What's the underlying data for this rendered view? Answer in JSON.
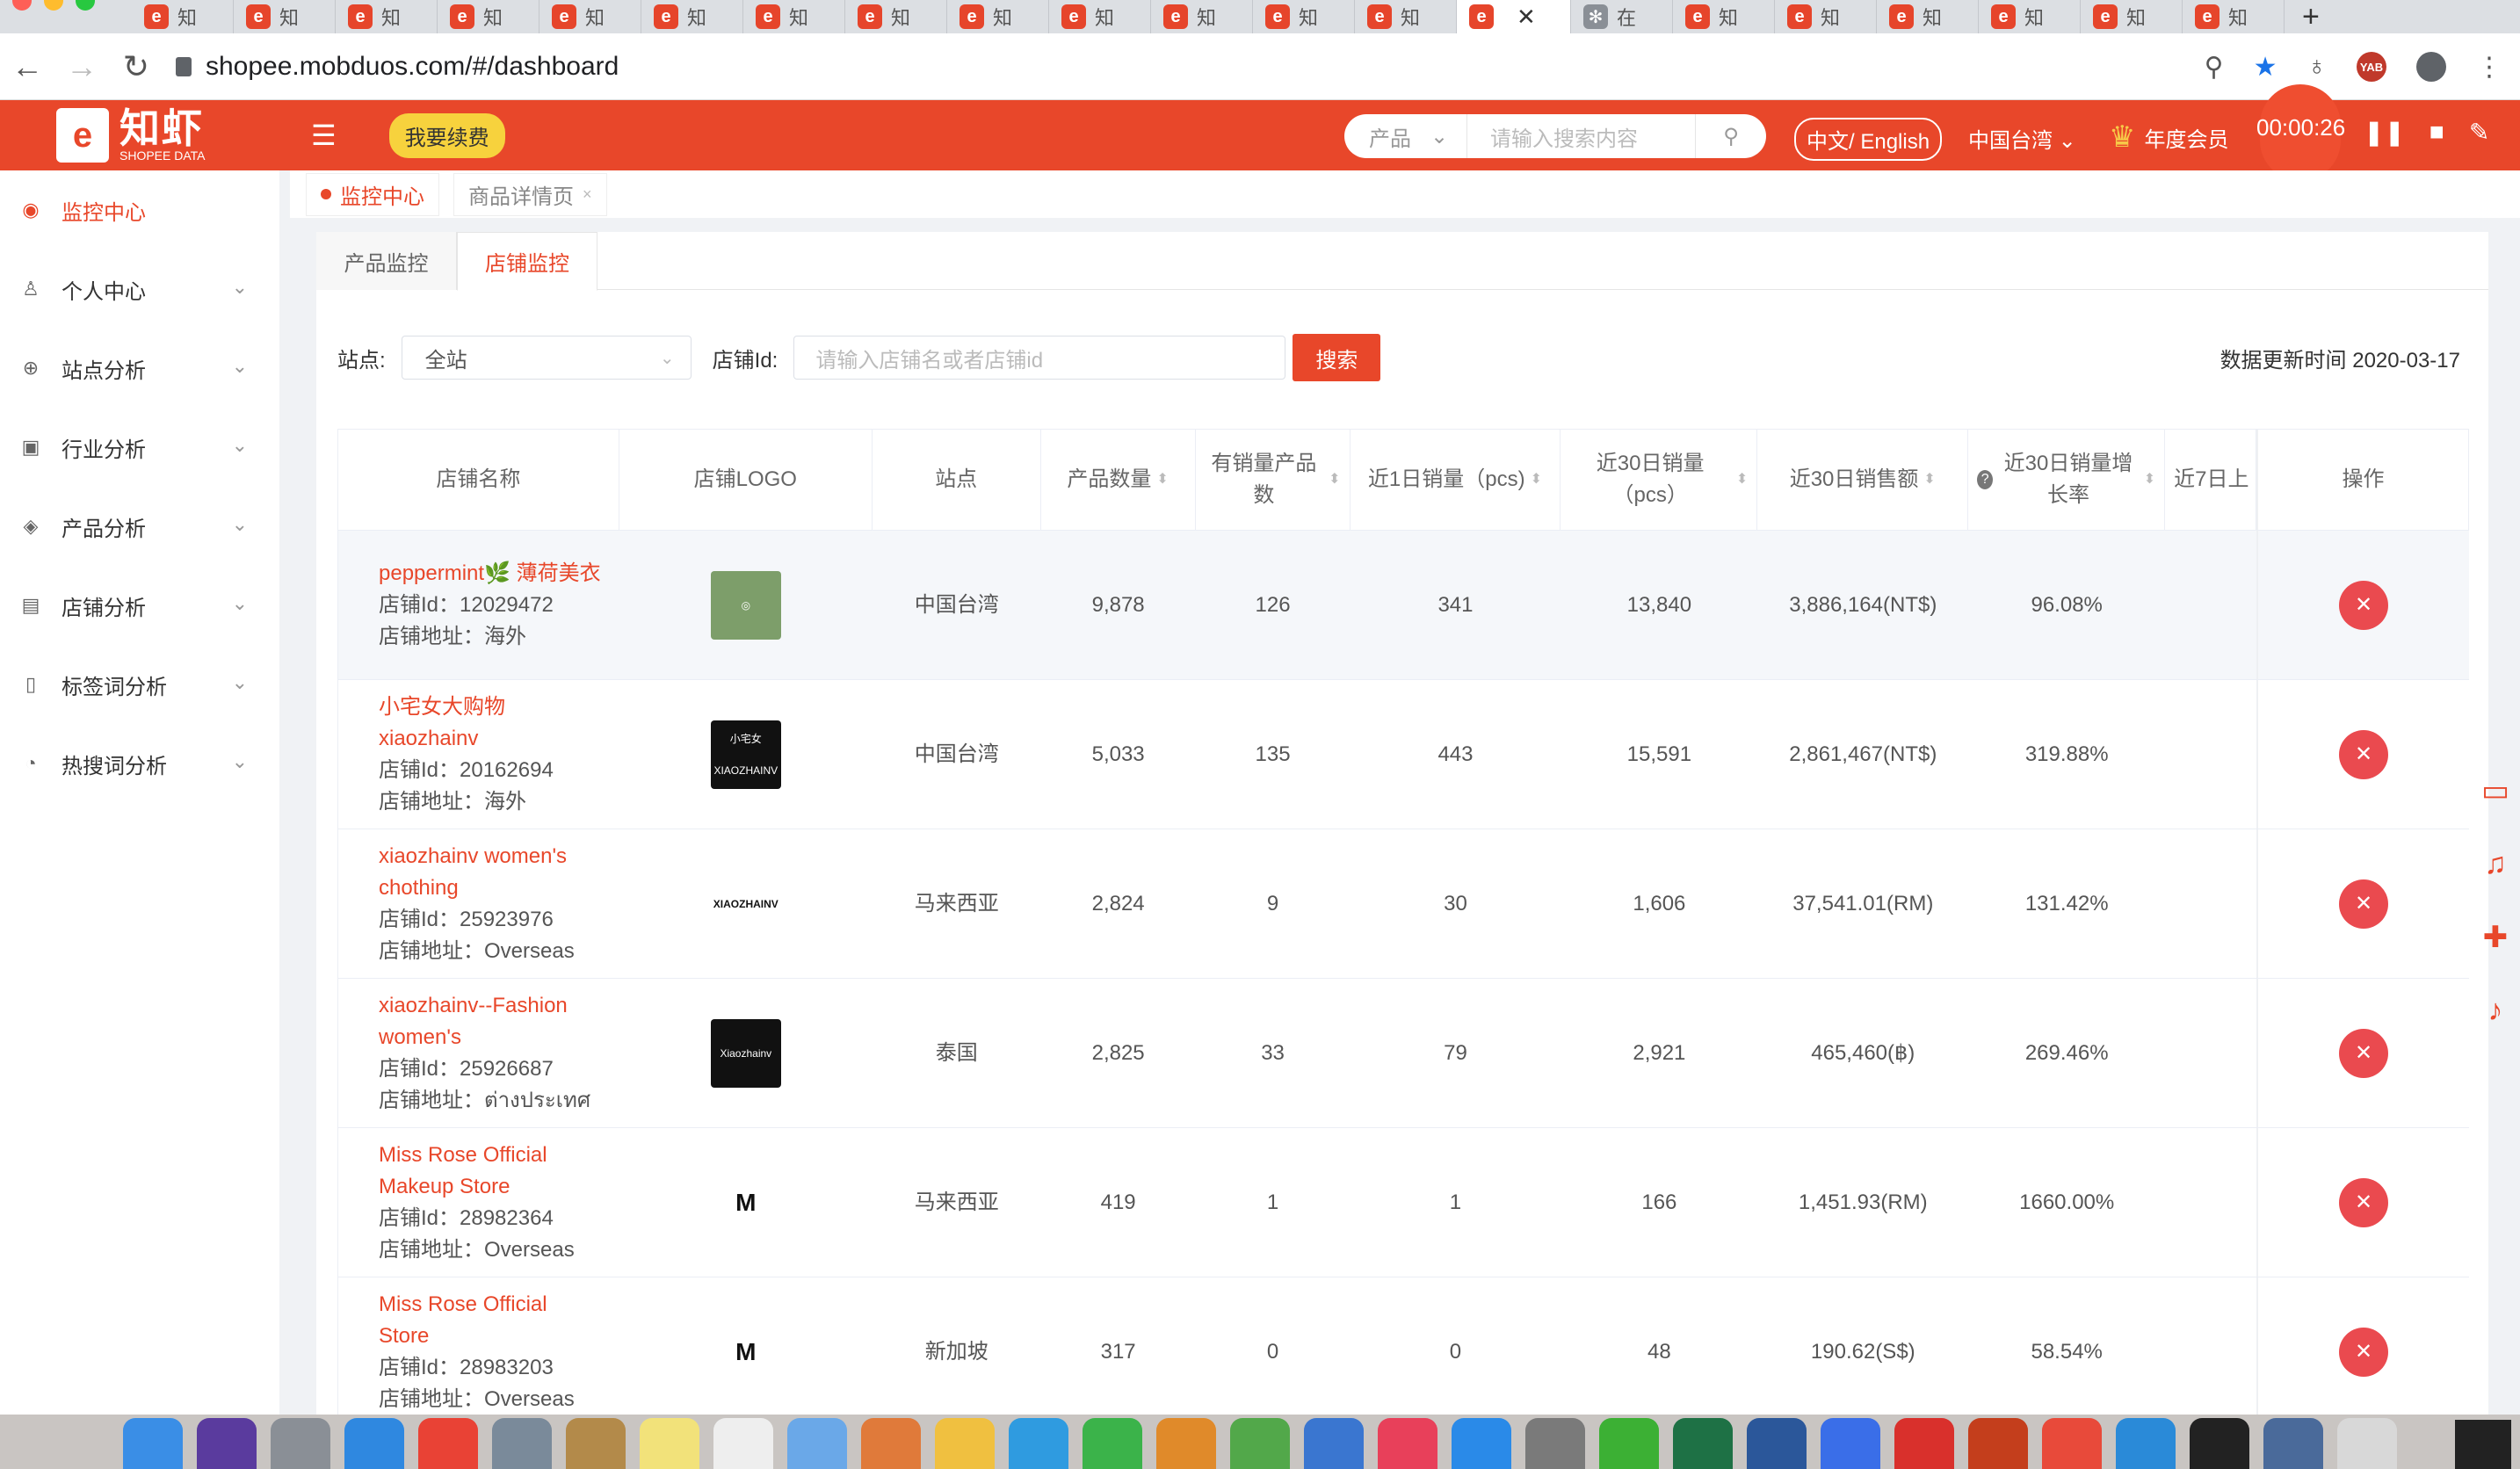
{
  "browser": {
    "tab_label": "知",
    "active_tab_close": "✕",
    "other_tab_label": "在",
    "new_tab": "+",
    "url": "shopee.mobduos.com/#/dashboard",
    "ext_badge": "YAB"
  },
  "header": {
    "logo_big": "知虾",
    "logo_small": "SHOPEE DATA",
    "renew": "我要续费",
    "search_type": "产品",
    "search_placeholder": "请输入搜索内容",
    "lang": "中文/ English",
    "region": "中国台湾",
    "member": "年度会员",
    "timer": "00:00:26"
  },
  "sidebar": {
    "items": [
      {
        "label": "监控中心",
        "icon": "dashboard-icon"
      },
      {
        "label": "个人中心",
        "icon": "user-icon"
      },
      {
        "label": "站点分析",
        "icon": "globe-icon"
      },
      {
        "label": "行业分析",
        "icon": "chart-icon"
      },
      {
        "label": "产品分析",
        "icon": "box-icon"
      },
      {
        "label": "店铺分析",
        "icon": "store-icon"
      },
      {
        "label": "标签词分析",
        "icon": "bookmark-icon"
      },
      {
        "label": "热搜词分析",
        "icon": "fire-icon"
      }
    ]
  },
  "crumbs": {
    "home": "监控中心",
    "detail": "商品详情页"
  },
  "tabs": {
    "product": "产品监控",
    "store": "店铺监控"
  },
  "filters": {
    "site_label": "站点:",
    "site_value": "全站",
    "store_label": "店铺Id:",
    "store_placeholder": "请输入店铺名或者店铺id",
    "search_btn": "搜索",
    "updated": "数据更新时间 2020-03-17"
  },
  "table": {
    "headers": [
      "店铺名称",
      "店铺LOGO",
      "站点",
      "产品数量",
      "有销量产品数",
      "近1日销量（pcs)",
      "近30日销量（pcs）",
      "近30日销售额",
      "近30日销量增长率",
      "近7日上",
      "操作"
    ],
    "rows": [
      {
        "name": "peppermint🌿 薄荷美衣",
        "id": "店铺Id：12029472",
        "addr": "店铺地址：海外",
        "logo_text": "",
        "site": "中国台湾",
        "qty": "9,878",
        "sold": "126",
        "d1": "341",
        "d30": "13,840",
        "amt": "3,886,164(NT$)",
        "grow": "96.08%"
      },
      {
        "name": "小宅女大购物xiaozhainv",
        "id": "店铺Id：20162694",
        "addr": "店铺地址：海外",
        "logo_text": "小宅女 XIAOZHAINV",
        "site": "中国台湾",
        "qty": "5,033",
        "sold": "135",
        "d1": "443",
        "d30": "15,591",
        "amt": "2,861,467(NT$)",
        "grow": "319.88%"
      },
      {
        "name": "xiaozhainv women's chothing",
        "id": "店铺Id：25923976",
        "addr": "店铺地址：Overseas",
        "logo_text": "XIAOZHAINV",
        "site": "马来西亚",
        "qty": "2,824",
        "sold": "9",
        "d1": "30",
        "d30": "1,606",
        "amt": "37,541.01(RM)",
        "grow": "131.42%"
      },
      {
        "name": "xiaozhainv--Fashion women's",
        "id": "店铺Id：25926687",
        "addr": "店铺地址：ต่างประเทศ",
        "logo_text": "Xiaozhainv",
        "site": "泰国",
        "qty": "2,825",
        "sold": "33",
        "d1": "79",
        "d30": "2,921",
        "amt": "465,460(฿)",
        "grow": "269.46%"
      },
      {
        "name": "Miss Rose Official Makeup Store",
        "id": "店铺Id：28982364",
        "addr": "店铺地址：Overseas",
        "logo_text": "M",
        "site": "马来西亚",
        "qty": "419",
        "sold": "1",
        "d1": "1",
        "d30": "166",
        "amt": "1,451.93(RM)",
        "grow": "1660.00%"
      },
      {
        "name": "Miss Rose Official Store",
        "id": "店铺Id：28983203",
        "addr": "店铺地址：Overseas",
        "logo_text": "M",
        "site": "新加坡",
        "qty": "317",
        "sold": "0",
        "d1": "0",
        "d30": "48",
        "amt": "190.62(S$)",
        "grow": "58.54%"
      }
    ]
  },
  "colors": {
    "brand": "#e8472a",
    "renew": "#f7d23d",
    "delete": "#ea4a4f"
  }
}
